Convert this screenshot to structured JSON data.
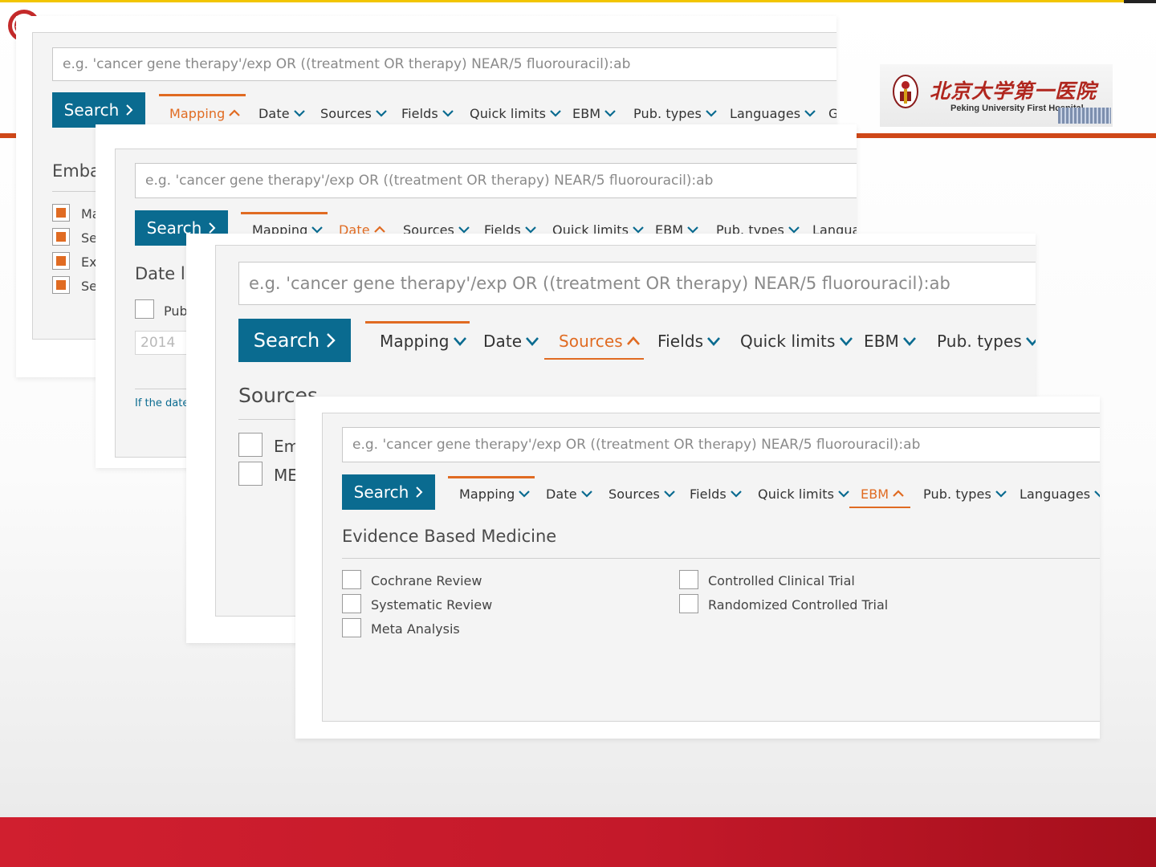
{
  "search_placeholder": "e.g. 'cancer gene therapy'/exp OR ((treatment OR therapy) NEAR/5 fluorouracil):ab",
  "search_label": "Search",
  "tabs": {
    "mapping": "Mapping",
    "date": "Date",
    "sources": "Sources",
    "fields": "Fields",
    "quick_limits": "Quick limits",
    "ebm": "EBM",
    "pub_types": "Pub. types",
    "languages": "Languages",
    "languages_cut": "Langua",
    "g_cut": "G"
  },
  "panel1": {
    "section_title": "Emba",
    "items": [
      "Ma",
      "Se",
      "Ex",
      "Se"
    ]
  },
  "panel2": {
    "section_title": "Date li",
    "pub_label": "Pub",
    "year_value": "2014",
    "note": "If the date"
  },
  "panel3": {
    "section_title": "Sources",
    "items": [
      "Em",
      "ME"
    ]
  },
  "panel4": {
    "section_title": "Evidence Based Medicine",
    "left_items": [
      "Cochrane Review",
      "Systematic Review",
      "Meta Analysis"
    ],
    "right_items": [
      "Controlled Clinical Trial",
      "Randomized Controlled Trial"
    ]
  },
  "logo": {
    "name_cn": "北京大学第一医院",
    "name_en": "Peking University First Hospital"
  },
  "colors": {
    "accent": "#e06b22",
    "brand_blue": "#0a6b90",
    "footer_red": "#c4192a",
    "rule_orange": "#cf4718"
  }
}
